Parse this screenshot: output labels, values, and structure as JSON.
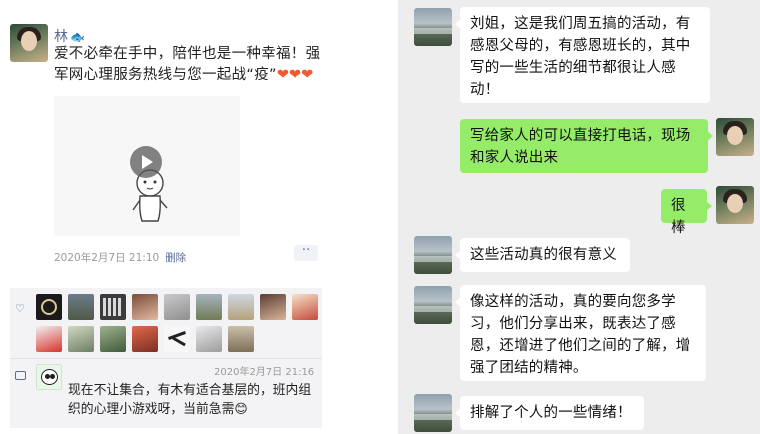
{
  "moment": {
    "author": "林",
    "author_emoji": "🐟",
    "text": "爱不必牵在手中，陪伴也是一种幸福！强军网心理服务热线与您一起战“疫”",
    "hearts": "❤❤❤",
    "timestamp": "2020年2月7日 21:10",
    "delete_label": "删除",
    "more_label": "··",
    "likes_count": 16,
    "comment": {
      "timestamp": "2020年2月7日 21:16",
      "text": "现在不让集合，有木有适合基层的，班内组织的心理小游戏呀，当前急需😊"
    }
  },
  "chat": {
    "messages": [
      {
        "side": "in",
        "text": "刘姐，这是我们周五搞的活动，有感恩父母的，有感恩班长的，其中写的一些生活的细节都很让人感动！"
      },
      {
        "side": "out",
        "text": "写给家人的可以直接打电话，现场和家人说出来"
      },
      {
        "side": "out",
        "text": "很棒"
      },
      {
        "side": "in",
        "text": "这些活动真的很有意义"
      },
      {
        "side": "in",
        "text": "像这样的活动，真的要向您多学习，他们分享出来，既表达了感恩，还增进了他们之间的了解，增强了团结的精神。"
      },
      {
        "side": "in",
        "text": "排解了个人的一些情绪！"
      }
    ]
  },
  "colors": {
    "link_blue": "#576b95",
    "bubble_green": "#95ec69",
    "chat_bg": "#ededed"
  }
}
